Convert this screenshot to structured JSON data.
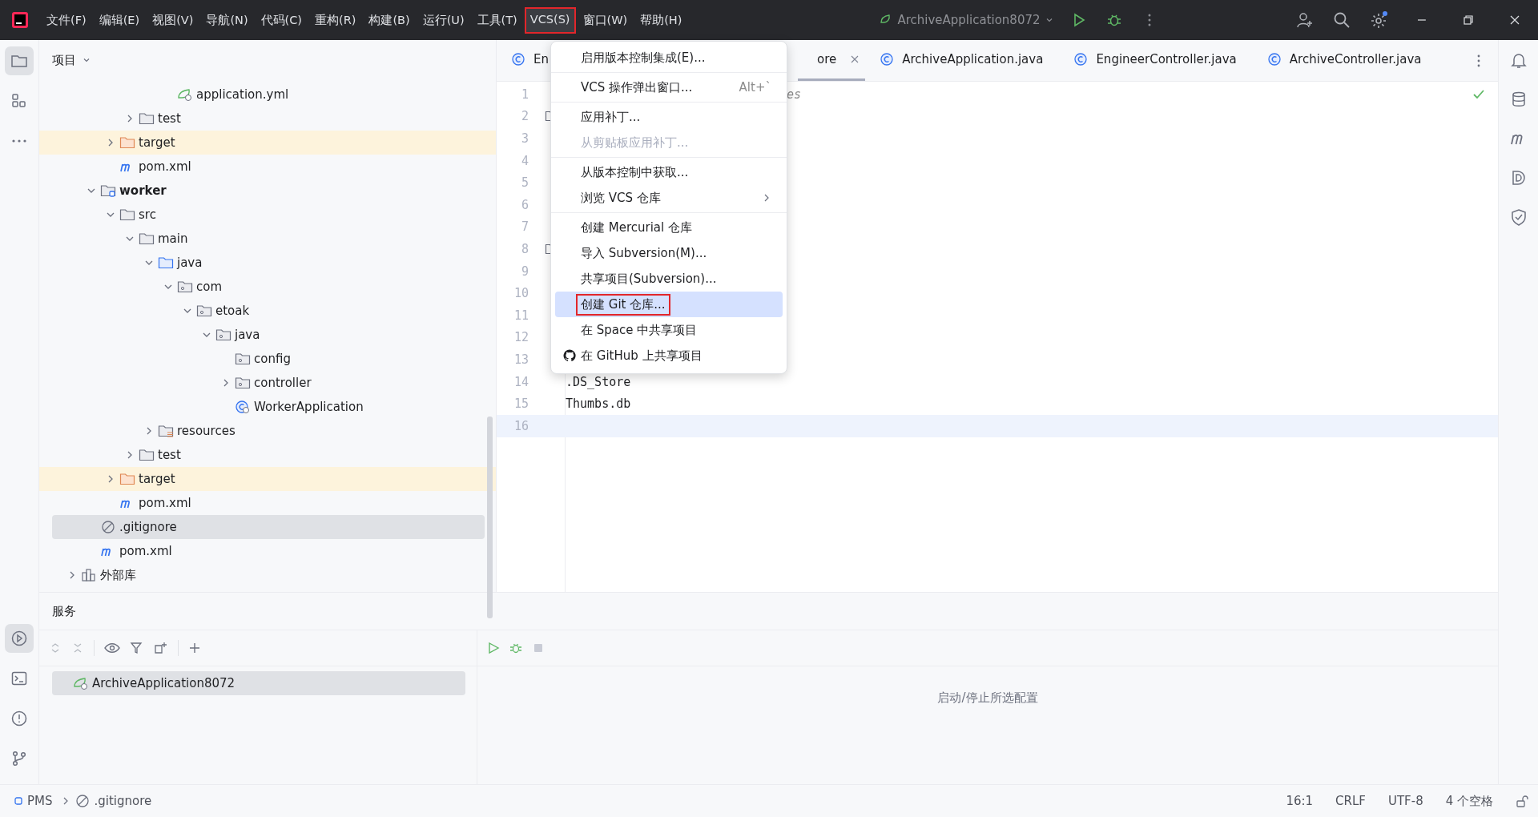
{
  "title_bar": {
    "menus": [
      {
        "label": "文件(F)",
        "selected": false,
        "annotated": false
      },
      {
        "label": "编辑(E)",
        "selected": false,
        "annotated": false
      },
      {
        "label": "视图(V)",
        "selected": false,
        "annotated": false
      },
      {
        "label": "导航(N)",
        "selected": false,
        "annotated": false
      },
      {
        "label": "代码(C)",
        "selected": false,
        "annotated": false
      },
      {
        "label": "重构(R)",
        "selected": false,
        "annotated": false
      },
      {
        "label": "构建(B)",
        "selected": false,
        "annotated": false
      },
      {
        "label": "运行(U)",
        "selected": false,
        "annotated": false
      },
      {
        "label": "工具(T)",
        "selected": false,
        "annotated": false
      },
      {
        "label": "VCS(S)",
        "selected": true,
        "annotated": true
      },
      {
        "label": "窗口(W)",
        "selected": false,
        "annotated": false
      },
      {
        "label": "帮助(H)",
        "selected": false,
        "annotated": false
      }
    ],
    "run_config": "ArchiveApplication8072"
  },
  "vcs_menu": {
    "groups": [
      [
        {
          "label": "启用版本控制集成(E)...",
          "disabled": false,
          "selected": false,
          "annotated": false
        }
      ],
      [
        {
          "label": "VCS 操作弹出窗口...",
          "shortcut": "Alt+`",
          "disabled": false,
          "selected": false,
          "annotated": false
        }
      ],
      [
        {
          "label": "应用补丁...",
          "disabled": false,
          "selected": false,
          "annotated": false
        },
        {
          "label": "从剪贴板应用补丁...",
          "disabled": true,
          "selected": false,
          "annotated": false
        }
      ],
      [
        {
          "label": "从版本控制中获取...",
          "disabled": false,
          "selected": false,
          "annotated": false
        },
        {
          "label": "浏览 VCS 仓库",
          "submenu": true,
          "disabled": false,
          "selected": false,
          "annotated": false
        }
      ],
      [
        {
          "label": "创建 Mercurial 仓库",
          "disabled": false,
          "selected": false,
          "annotated": false
        },
        {
          "label": "导入 Subversion(M)...",
          "disabled": false,
          "selected": false,
          "annotated": false
        },
        {
          "label": "共享项目(Subversion)...",
          "disabled": false,
          "selected": false,
          "annotated": false
        },
        {
          "label": "创建 Git 仓库...",
          "disabled": false,
          "selected": true,
          "annotated": true
        },
        {
          "label": "在 Space 中共享项目",
          "disabled": false,
          "selected": false,
          "annotated": false
        },
        {
          "label": "在 GitHub 上共享项目",
          "kind": "github",
          "disabled": false,
          "selected": false,
          "annotated": false
        }
      ]
    ]
  },
  "left_toolbar": {
    "top": [
      {
        "kind": "project",
        "selected": true
      },
      {
        "kind": "structure",
        "selected": false
      },
      {
        "kind": "more",
        "selected": false
      }
    ],
    "bottom": [
      {
        "kind": "services",
        "selected": true
      },
      {
        "kind": "terminal",
        "selected": false
      },
      {
        "kind": "problems",
        "selected": false
      },
      {
        "kind": "git",
        "selected": false
      }
    ]
  },
  "project_panel": {
    "title": "项目",
    "tree": [
      {
        "children": [
          {
            "children": [
              {
                "children": [
                  {
                    "children": [
                      {
                        "children": [
                          {
                            "label": "application.yml",
                            "kind": "spring",
                            "selected": false
                          }
                        ]
                      }
                    ]
                  },
                  {
                    "label": "test",
                    "kind": "folder",
                    "expanded": false,
                    "selected": false
                  }
                ]
              },
              {
                "label": "target",
                "kind": "excluded",
                "expanded": false,
                "selected": false
              },
              {
                "label": "pom.xml",
                "kind": "maven",
                "selected": false
              }
            ]
          },
          {
            "label": "worker",
            "kind": "module",
            "expanded": true,
            "selected": false,
            "children": [
              {
                "label": "src",
                "kind": "folder",
                "expanded": true,
                "selected": false,
                "children": [
                  {
                    "label": "main",
                    "kind": "folder",
                    "expanded": true,
                    "selected": false,
                    "children": [
                      {
                        "label": "java",
                        "kind": "source",
                        "expanded": true,
                        "selected": false,
                        "children": [
                          {
                            "label": "com",
                            "kind": "package",
                            "expanded": true,
                            "selected": false,
                            "children": [
                              {
                                "label": "etoak",
                                "kind": "package",
                                "expanded": true,
                                "selected": false,
                                "children": [
                                  {
                                    "label": "java",
                                    "kind": "package",
                                    "expanded": true,
                                    "selected": false,
                                    "children": [
                                      {
                                        "label": "config",
                                        "kind": "package",
                                        "selected": false
                                      },
                                      {
                                        "label": "controller",
                                        "kind": "package",
                                        "expanded": false,
                                        "selected": false
                                      },
                                      {
                                        "label": "WorkerApplication",
                                        "kind": "class",
                                        "selected": false
                                      }
                                    ]
                                  }
                                ]
                              }
                            ]
                          }
                        ]
                      },
                      {
                        "label": "resources",
                        "kind": "resources",
                        "expanded": false,
                        "selected": false
                      }
                    ]
                  },
                  {
                    "label": "test",
                    "kind": "folder",
                    "expanded": false,
                    "selected": false
                  }
                ]
              },
              {
                "label": "target",
                "kind": "excluded",
                "expanded": false,
                "selected": false
              },
              {
                "label": "pom.xml",
                "kind": "maven",
                "selected": false
              }
            ]
          },
          {
            "label": ".gitignore",
            "kind": "ignore",
            "selected": true
          },
          {
            "label": "pom.xml",
            "kind": "maven",
            "selected": false
          }
        ]
      },
      {
        "label": "外部库",
        "kind": "library",
        "expanded": false,
        "selected": false
      }
    ]
  },
  "editor": {
    "tabs": [
      {
        "label": "En",
        "selected": false,
        "closable": false
      },
      {
        "label": "ore",
        "selected": true,
        "closable": true
      },
      {
        "label": "ArchiveApplication.java",
        "selected": false,
        "closable": false
      },
      {
        "label": "EngineerController.java",
        "selected": false,
        "closable": false
      },
      {
        "label": "ArchiveController.java",
        "selected": false,
        "closable": false
      }
    ],
    "lines": [
      {
        "number": "1",
        "text": "es",
        "partially_hidden": true
      },
      {
        "number": "2",
        "fold": true
      },
      {
        "number": "3"
      },
      {
        "number": "4"
      },
      {
        "number": "5"
      },
      {
        "number": "6"
      },
      {
        "number": "7"
      },
      {
        "number": "8",
        "fold": true
      },
      {
        "number": "9"
      },
      {
        "number": "10"
      },
      {
        "number": "11"
      },
      {
        "number": "12"
      },
      {
        "number": "13"
      },
      {
        "number": "14",
        "text": ".DS_Store"
      },
      {
        "number": "15",
        "text": "Thumbs.db"
      },
      {
        "number": "16",
        "current": true
      }
    ]
  },
  "services": {
    "title": "服务",
    "items": [
      {
        "label": "ArchiveApplication8072",
        "selected": true
      }
    ],
    "empty_hint": "启动/停止所选配置"
  },
  "status_bar": {
    "breadcrumbs": [
      "PMS",
      ".gitignore"
    ],
    "position": "16:1",
    "line_separator": "CRLF",
    "encoding": "UTF-8",
    "indent": "4 个空格"
  }
}
